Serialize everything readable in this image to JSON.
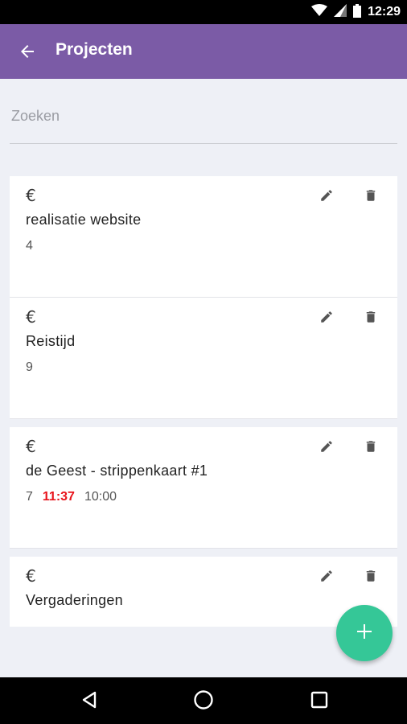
{
  "status_bar": {
    "time": "12:29"
  },
  "app_bar": {
    "title": "Projecten"
  },
  "search": {
    "placeholder": "Zoeken",
    "value": ""
  },
  "projects": [
    {
      "currency_symbol": "€",
      "name": "realisatie website",
      "count": "4"
    },
    {
      "currency_symbol": "€",
      "name": "Reistijd",
      "count": "9"
    },
    {
      "currency_symbol": "€",
      "name": "de Geest - strippenkaart #1",
      "count": "7",
      "time_used": "11:37",
      "time_total": "10:00"
    },
    {
      "currency_symbol": "€",
      "name": "Vergaderingen"
    }
  ],
  "icons": {
    "back": "arrow-back-icon",
    "edit": "pencil-icon",
    "delete": "trash-icon",
    "add": "plus-icon"
  },
  "colors": {
    "app_bar": "#7b5ba6",
    "fab": "#35c797",
    "overtime_text": "#e8141c",
    "background": "#eef0f6"
  }
}
